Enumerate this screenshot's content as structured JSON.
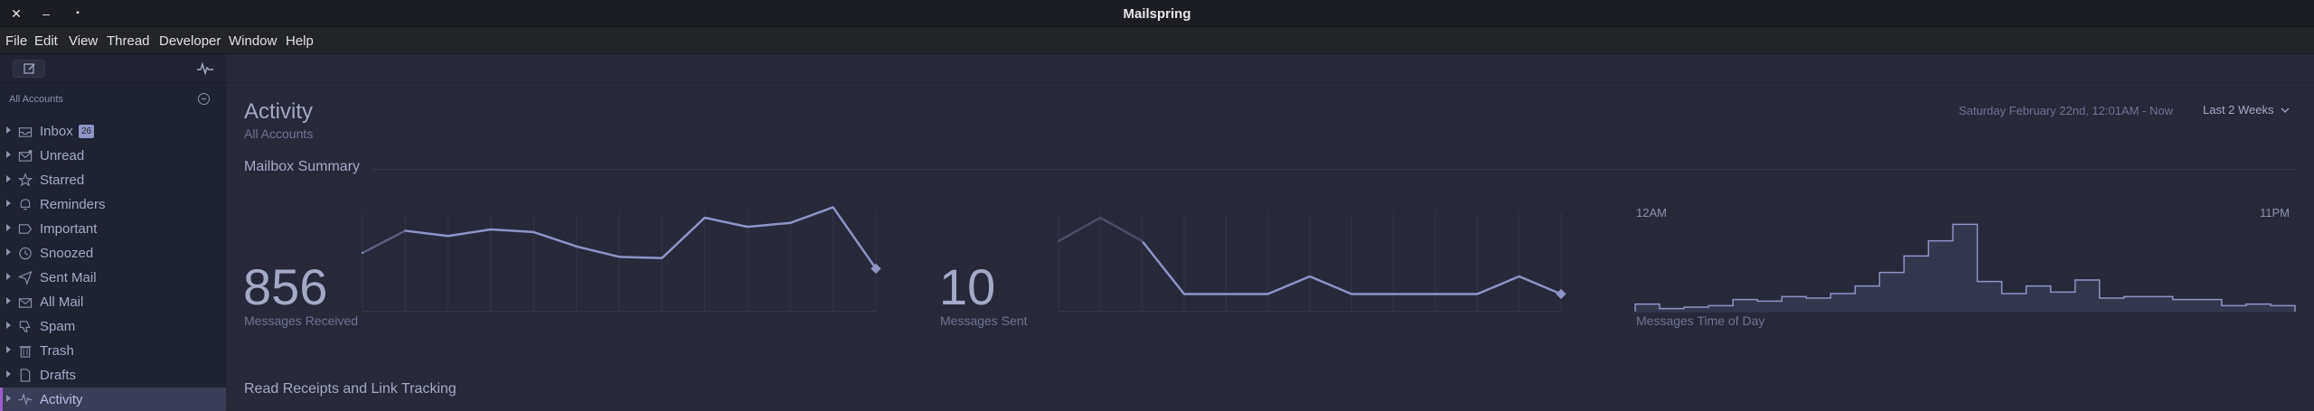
{
  "window": {
    "title": "Mailspring",
    "close_glyph": "✕",
    "minimize_glyph": "–",
    "maximize_glyph": "▪"
  },
  "menu": [
    "File",
    "Edit",
    "View",
    "Thread",
    "Developer",
    "Window",
    "Help"
  ],
  "sidebar": {
    "account_header": "All Accounts",
    "folders": [
      {
        "label": "Inbox",
        "icon": "inbox-icon",
        "badge": "26"
      },
      {
        "label": "Unread",
        "icon": "unread-icon"
      },
      {
        "label": "Starred",
        "icon": "star-icon"
      },
      {
        "label": "Reminders",
        "icon": "bell-icon"
      },
      {
        "label": "Important",
        "icon": "important-icon"
      },
      {
        "label": "Snoozed",
        "icon": "clock-icon"
      },
      {
        "label": "Sent Mail",
        "icon": "send-icon"
      },
      {
        "label": "All Mail",
        "icon": "all-mail-icon"
      },
      {
        "label": "Spam",
        "icon": "thumbs-down-icon"
      },
      {
        "label": "Trash",
        "icon": "trash-icon"
      },
      {
        "label": "Drafts",
        "icon": "drafts-icon"
      },
      {
        "label": "Activity",
        "icon": "activity-icon",
        "active": true
      }
    ]
  },
  "activity": {
    "title": "Activity",
    "subtitle": "All Accounts",
    "date_range": "Saturday February 22nd, 12:01AM - Now",
    "period": "Last 2 Weeks",
    "mailbox_summary": "Mailbox Summary",
    "received": {
      "count": "856",
      "label": "Messages Received"
    },
    "sent": {
      "count": "10",
      "label": "Messages Sent"
    },
    "time_of_day": {
      "label": "Messages Time of Day",
      "start": "12AM",
      "end": "11PM"
    },
    "read_receipts": "Read Receipts and Link Tracking"
  },
  "chart_data": [
    {
      "type": "line",
      "name": "Messages Received",
      "values": [
        55,
        72,
        68,
        73,
        71,
        60,
        52,
        51,
        82,
        75,
        78,
        90,
        43
      ]
    },
    {
      "type": "line",
      "name": "Messages Sent",
      "values": [
        1.2,
        1.6,
        1.2,
        0.3,
        0.3,
        0.3,
        0.6,
        0.3,
        0.3,
        0.3,
        0.3,
        0.6,
        0.3
      ],
      "faded_points": 3
    },
    {
      "type": "bar",
      "name": "Messages Time of Day",
      "values": [
        5,
        2,
        3,
        4,
        8,
        7,
        10,
        9,
        12,
        17,
        26,
        37,
        47,
        58,
        20,
        12,
        17,
        13,
        21,
        9,
        10,
        10,
        8,
        8,
        4,
        5,
        4
      ]
    }
  ],
  "colors": {
    "accent": "#8d94c6",
    "active_bar": "#9c5fcf",
    "line_faded": "#4a4d66"
  }
}
